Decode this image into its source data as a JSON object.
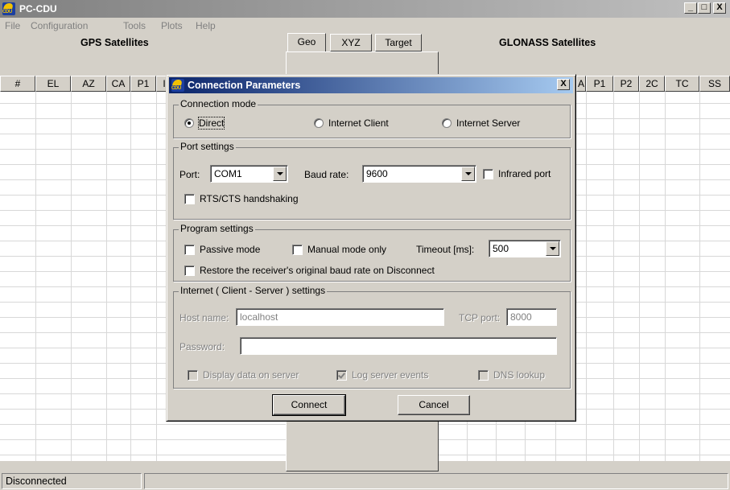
{
  "window": {
    "title": "PC-CDU",
    "minimize_label": "_",
    "maximize_label": "□",
    "close_label": "X"
  },
  "menu": [
    "File",
    "Configuration",
    "Tools",
    "Plots",
    "Help"
  ],
  "header": {
    "gps_title": "GPS Satellites",
    "glonass_title": "GLONASS Satellites",
    "tabs": [
      "Geo",
      "XYZ",
      "Target"
    ]
  },
  "gps_columns": [
    "#",
    "EL",
    "AZ",
    "CA",
    "P1",
    "I"
  ],
  "glonass_columns": [
    "A",
    "P1",
    "P2",
    "2C",
    "TC",
    "SS"
  ],
  "status": {
    "text": "Disconnected"
  },
  "dialog": {
    "title": "Connection Parameters",
    "close_label": "X",
    "connection_mode": {
      "label": "Connection mode",
      "options": [
        "Direct",
        "Internet Client",
        "Internet Server"
      ],
      "selected": "Direct"
    },
    "port_settings": {
      "label": "Port settings",
      "port_label": "Port:",
      "port_value": "COM1",
      "baud_label": "Baud rate:",
      "baud_value": "9600",
      "infrared_label": "Infrared port",
      "infrared_checked": false,
      "rts_label": "RTS/CTS handshaking",
      "rts_checked": false
    },
    "program_settings": {
      "label": "Program settings",
      "passive_label": "Passive mode",
      "passive_checked": false,
      "manual_label": "Manual mode only",
      "manual_checked": false,
      "timeout_label": "Timeout [ms]:",
      "timeout_value": "500",
      "restore_label": "Restore the receiver's original baud rate on Disconnect",
      "restore_checked": false
    },
    "internet_settings": {
      "label": "Internet ( Client - Server ) settings",
      "host_label": "Host name:",
      "host_value": "localhost",
      "tcp_label": "TCP port:",
      "tcp_value": "8000",
      "password_label": "Password:",
      "password_value": "",
      "display_label": "Display data on server",
      "display_checked": false,
      "log_label": "Log server events",
      "log_checked": true,
      "dns_label": "DNS lookup",
      "dns_checked": false
    },
    "connect_label": "Connect",
    "cancel_label": "Cancel"
  },
  "colors": {
    "dialog_title_start": "#0a246a",
    "dialog_title_end": "#a6caf0",
    "app_title_start": "#808080",
    "face": "#d4d0c8"
  }
}
